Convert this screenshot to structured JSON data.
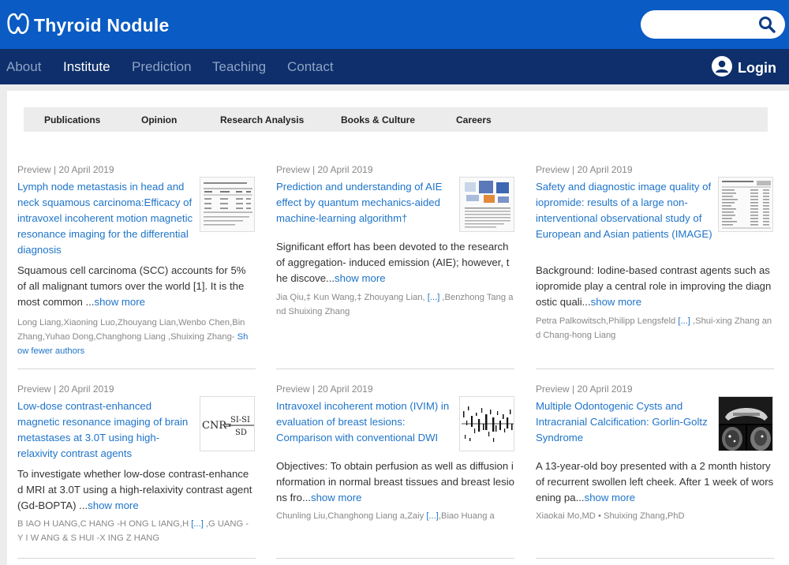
{
  "header": {
    "logo_text": "Thyroid Nodule",
    "search_placeholder": ""
  },
  "nav": {
    "items": [
      "About",
      "Institute",
      "Prediction",
      "Teaching",
      "Contact"
    ],
    "active": "Institute",
    "login_label": "Login"
  },
  "subnav": {
    "items": [
      "Publications",
      "Opinion",
      "Research Analysis",
      "Books & Culture",
      "Careers"
    ]
  },
  "articles": [
    {
      "meta": "Preview | 20 April 2019",
      "title": "Lymph node metastasis in head and neck squamous carcinoma:Efficacy of intravoxel incoherent motion magnetic resonance imaging for the differential diagnosis",
      "abstract": "Squamous cell carcinoma (SCC) accounts for 5% of all malignant tumors over the world [1]. It is the most common ...",
      "more": "show more",
      "authors": "Long Liang,Xiaoning Luo,Zhouyang Lian,Wenbo Chen,Bin Zhang,Yuhao Dong,Changhong Liang ,Shuixing Zhang- ",
      "authors_link": "Show fewer authors",
      "thumb": "table"
    },
    {
      "meta": "Preview | 20 April 2019",
      "title": "Prediction and understanding of AIE effect by quantum mechanics-aided machine-learning algorithm†",
      "abstract": "Significant effort has been devoted to the research of aggregation- induced emission (AIE); however, the discove...",
      "more": "show more",
      "authors": "Jia Qiu,‡ Kun Wang,‡ Zhouyang Lian, ",
      "authors_link": "[...]",
      "authors_tail": " ,Benzhong Tang and Shuixing Zhang",
      "thumb": "figure"
    },
    {
      "meta": "Preview | 20 April 2019",
      "title": "Safety and diagnostic image quality of iopromide: results of a large non-interventional observational study of European and Asian patients (IMAGE)",
      "abstract": "Background: Iodine-based contrast agents such as iopromide play a central role in improving the diagnostic quali...",
      "more": "show more",
      "authors": "Petra Palkowitsch,Philipp Lengsfeld ",
      "authors_link": "[...]",
      "authors_tail": " ,Shui-xing Zhang and Chang-hong Liang",
      "thumb": "doc"
    },
    {
      "meta": "Preview | 20 April 2019",
      "title": "Low-dose contrast-enhanced magnetic resonance imaging of brain metastases at 3.0T using high-relaxivity contrast agents",
      "abstract": "To investigate whether low-dose contrast-enhanced MRI at 3.0T using a high-relaxivity contrast agent (Gd-BOPTA) ...",
      "more": "show more",
      "authors": "B IAO H UANG,C HANG -H ONG L IANG,H ",
      "authors_link": "[...]",
      "authors_tail": " ,G UANG -Y I W ANG & S HUI -X ING Z HANG",
      "thumb": "formula"
    },
    {
      "meta": "Preview | 20 April 2019",
      "title": "Intravoxel incoherent motion (IVIM) in evaluation of breast lesions: Comparison with conventional DWI",
      "abstract": "Objectives: To obtain perfusion as well as diffusion information in normal breast tissues and breast lesions fro...",
      "more": "show more",
      "authors": "Chunling Liu,Changhong Liang a,Zaiy ",
      "authors_link": "[...]",
      "authors_tail": ",Biao Huang a",
      "thumb": "noise"
    },
    {
      "meta": "Preview | 20 April 2019",
      "title": "Multiple Odontogenic Cysts and Intracranial Calcification: Gorlin-Goltz Syndrome",
      "abstract": "A 13-year-old boy presented with a 2 month history of recurrent swollen left cheek. After 1 week of worsening pa...",
      "more": "show more",
      "authors": "Xiaokai Mo,MD • Shuixing Zhang,PhD",
      "thumb": "xray"
    }
  ]
}
